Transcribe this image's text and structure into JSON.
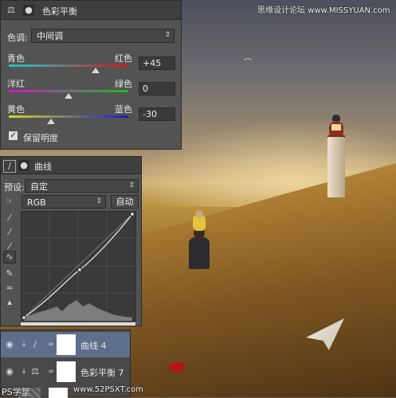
{
  "watermark": {
    "top_right": "思缘设计论坛 www.MISSYUAN.com",
    "bottom_left": "PS学堂",
    "bottom_url": "www.52PSXT.com"
  },
  "color_balance": {
    "title": "色彩平衡",
    "tone_label": "色调:",
    "tone_value": "中间调",
    "rows": [
      {
        "left": "青色",
        "right": "红色",
        "value": "+45",
        "level": 45
      },
      {
        "left": "洋红",
        "right": "绿色",
        "value": "0",
        "level": 0
      },
      {
        "left": "黄色",
        "right": "蓝色",
        "value": "-30",
        "level": -30
      }
    ],
    "preserve_label": "保留明度",
    "preserve_checked": true
  },
  "curves": {
    "title": "曲线",
    "preset_label": "预设:",
    "preset_value": "自定",
    "channel_value": "RGB",
    "auto_label": "自动"
  },
  "layers": [
    {
      "name": "曲线 4",
      "selected": true
    },
    {
      "name": "色彩平衡 7",
      "selected": false
    }
  ],
  "colors": {
    "panel": "#535353",
    "selected_layer": "#5d6f8a"
  },
  "icons": [
    "eye-icon",
    "link-icon",
    "scale-icon",
    "curves-icon",
    "checkbox-icon",
    "eyedropper-icon",
    "pencil-icon",
    "hand-icon"
  ]
}
